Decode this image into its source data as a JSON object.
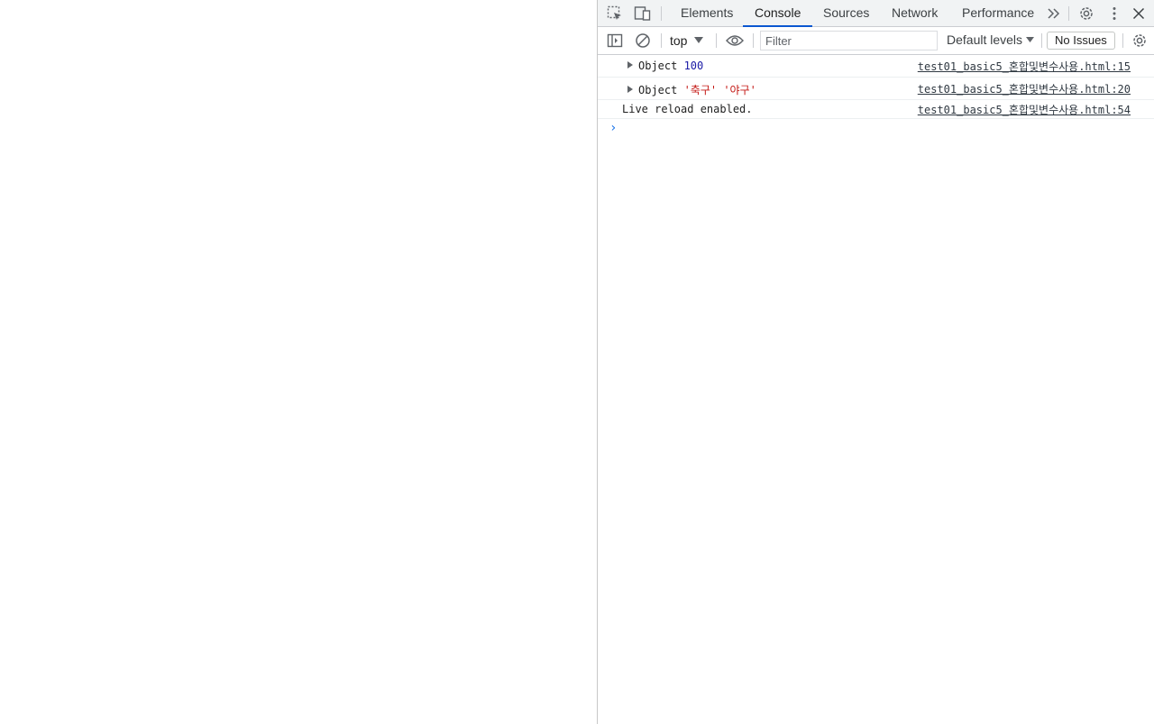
{
  "devtools": {
    "tabs": [
      {
        "label": "Elements"
      },
      {
        "label": "Console"
      },
      {
        "label": "Sources"
      },
      {
        "label": "Network"
      },
      {
        "label": "Performance"
      }
    ],
    "active_tab": "Console",
    "accent_color": "#0b57d0"
  },
  "toolbar": {
    "context": "top",
    "filter_placeholder": "Filter",
    "levels": "Default levels",
    "issues": "No Issues"
  },
  "console": {
    "messages": [
      {
        "prefix": "Object ",
        "value": "100",
        "source": "test01_basic5_혼합및변수사용.html:15"
      },
      {
        "prefix": "Object ",
        "value": "'축구' '야구'",
        "source": "test01_basic5_혼합및변수사용.html:20"
      },
      {
        "text": "Live reload enabled.",
        "source": "test01_basic5_혼합및변수사용.html:54"
      }
    ]
  }
}
